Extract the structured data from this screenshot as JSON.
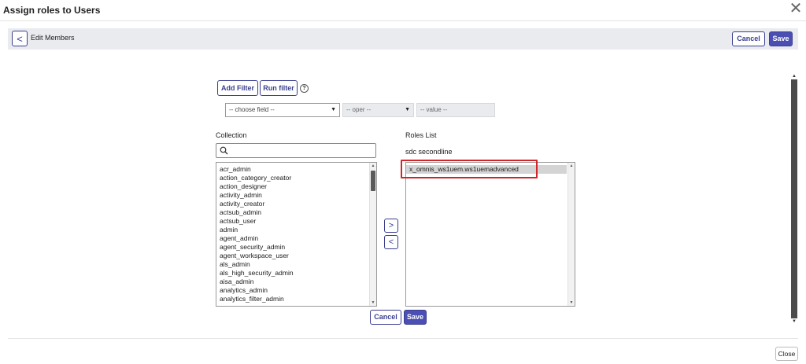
{
  "dialog": {
    "title": "Assign roles to Users",
    "close_glyph": "✕"
  },
  "header": {
    "back_glyph": "<",
    "title": "Edit Members",
    "cancel_label": "Cancel",
    "save_label": "Save"
  },
  "filter": {
    "add_filter_label": "Add Filter",
    "run_filter_label": "Run filter",
    "help_glyph": "?",
    "field_select": "-- choose field --",
    "oper_select": "-- oper --",
    "value_input": "-- value --"
  },
  "collection": {
    "label": "Collection",
    "search_value": "",
    "items": [
      "acr_admin",
      "action_category_creator",
      "action_designer",
      "activity_admin",
      "activity_creator",
      "actsub_admin",
      "actsub_user",
      "admin",
      "agent_admin",
      "agent_security_admin",
      "agent_workspace_user",
      "als_admin",
      "als_high_security_admin",
      "aisa_admin",
      "analytics_admin",
      "analytics_filter_admin"
    ],
    "scroll_position": 0.08
  },
  "transfer": {
    "add_glyph": ">",
    "remove_glyph": "<"
  },
  "roles": {
    "label": "Roles List",
    "group_name": "sdc secondline",
    "items": [
      "x_omnis_ws1uem.ws1uemadvanced"
    ]
  },
  "footer": {
    "cancel_label": "Cancel",
    "save_label": "Save",
    "close_label": "Close"
  },
  "icons": {
    "search": "search-icon",
    "help": "question-circle-icon",
    "back": "chevron-left-icon",
    "close": "close-icon"
  },
  "colors": {
    "accent": "#4b4fb3",
    "accent_border": "#3a3f8f",
    "highlight": "#d0262a",
    "header_bg": "#e9ebef"
  }
}
